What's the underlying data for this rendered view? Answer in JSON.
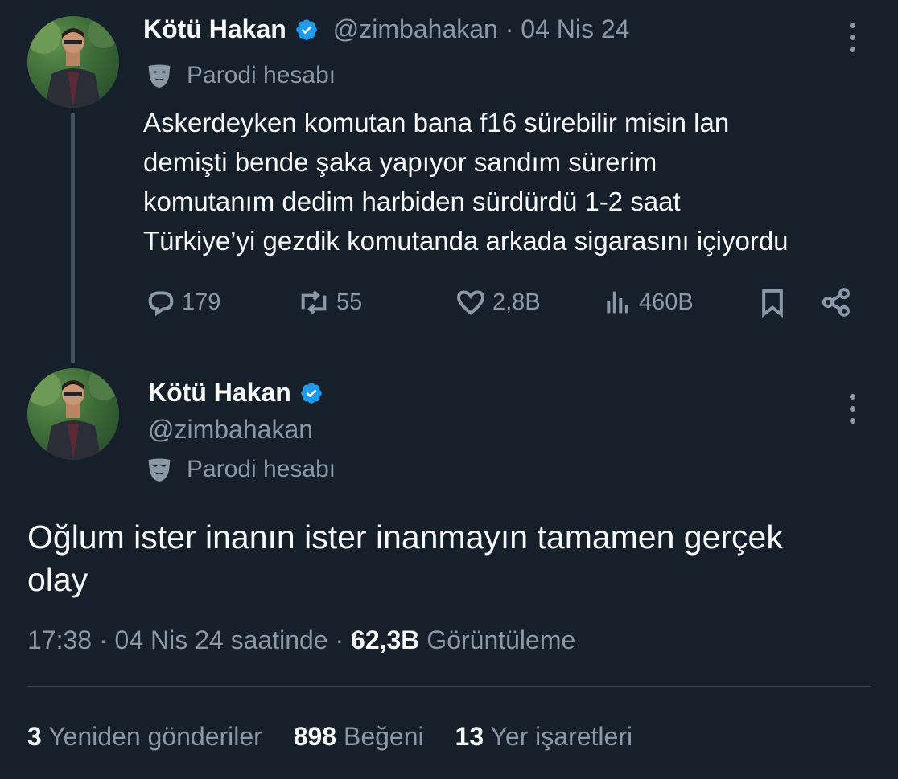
{
  "quoted_tweet": {
    "author_name": "Kötü Hakan",
    "handle_and_date": "@zimbahakan · 04 Nis 24",
    "parody_label": "Parodi hesabı",
    "text_lines": [
      "Askerdeyken komutan bana f16 sürebilir misin lan",
      "demişti bende şaka yapıyor sandım sürerim",
      "komutanım dedim harbiden sürdürdü 1-2 saat",
      "Türkiye’yi gezdik komutanda arkada sigarasını içiyordu"
    ],
    "actions": {
      "replies": "179",
      "reposts": "55",
      "likes": "2,8B",
      "views": "460B"
    }
  },
  "main_tweet": {
    "author_name": "Kötü Hakan",
    "handle": "@zimbahakan",
    "parody_label": "Parodi hesabı",
    "text_lines": [
      "Oğlum ister inanın ister inanmayın tamamen gerçek",
      "olay"
    ],
    "meta": {
      "time_date": "17:38 · 04 Nis 24 saatinde · ",
      "views_count": "62,3B",
      "views_label": "Görüntüleme"
    },
    "stats": {
      "reposts_count": "3",
      "reposts_label": "Yeniden gönderiler",
      "likes_count": "898",
      "likes_label": "Beğeni",
      "bookmarks_count": "13",
      "bookmarks_label": "Yer işaretleri"
    }
  },
  "colors": {
    "background": "#15202b",
    "text": "#f7f9f9",
    "muted": "#8b98a5",
    "verified": "#1d9bf0"
  },
  "icons": [
    "verified-badge-icon",
    "parody-mask-icon",
    "reply-icon",
    "repost-icon",
    "like-icon",
    "views-icon",
    "bookmark-icon",
    "share-icon",
    "more-icon"
  ]
}
